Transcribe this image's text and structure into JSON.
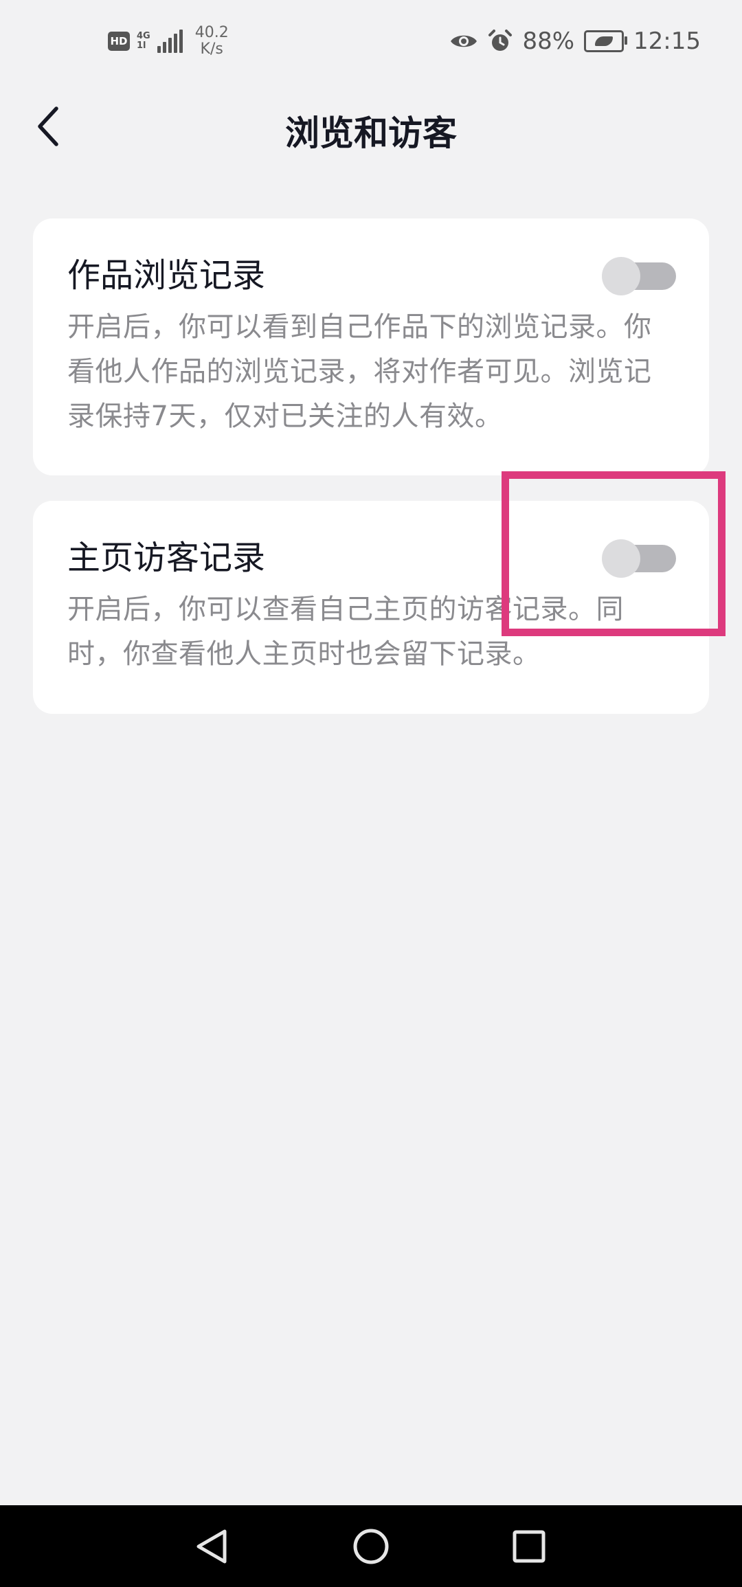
{
  "status_bar": {
    "hd": "HD",
    "network_top": "4G",
    "network_bottom": "1l",
    "speed_value": "40.2",
    "speed_unit": "K/s",
    "battery_percent": "88%",
    "time": "12:15"
  },
  "header": {
    "title": "浏览和访客"
  },
  "settings": [
    {
      "title": "作品浏览记录",
      "description": "开启后，你可以看到自己作品下的浏览记录。你看他人作品的浏览记录，将对作者可见。浏览记录保持7天，仅对已关注的人有效。",
      "enabled": false
    },
    {
      "title": "主页访客记录",
      "description": "开启后，你可以查看自己主页的访客记录。同时，你查看他人主页时也会留下记录。",
      "enabled": false
    }
  ],
  "colors": {
    "background": "#f2f2f3",
    "card": "#ffffff",
    "highlight": "#dd3a7d",
    "toggle_off_track": "#b7b7bb"
  }
}
